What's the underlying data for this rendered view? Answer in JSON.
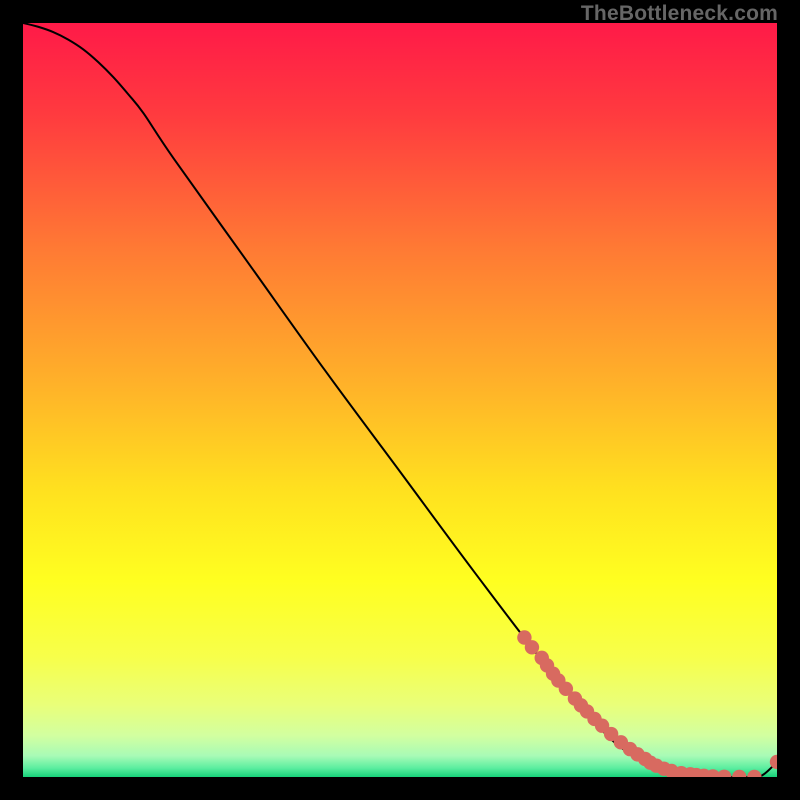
{
  "watermark": "TheBottleneck.com",
  "chart_data": {
    "type": "line",
    "title": "",
    "xlabel": "",
    "ylabel": "",
    "xlim": [
      0,
      100
    ],
    "ylim": [
      0,
      100
    ],
    "background_gradient": {
      "stops": [
        {
          "offset": 0,
          "color": "#ff1a48"
        },
        {
          "offset": 0.12,
          "color": "#ff3a3f"
        },
        {
          "offset": 0.3,
          "color": "#ff7a34"
        },
        {
          "offset": 0.48,
          "color": "#ffb229"
        },
        {
          "offset": 0.62,
          "color": "#ffe11f"
        },
        {
          "offset": 0.74,
          "color": "#ffff20"
        },
        {
          "offset": 0.84,
          "color": "#f7ff4a"
        },
        {
          "offset": 0.905,
          "color": "#e9ff7a"
        },
        {
          "offset": 0.945,
          "color": "#d2ffa0"
        },
        {
          "offset": 0.972,
          "color": "#a8fbb6"
        },
        {
          "offset": 0.988,
          "color": "#5ceea0"
        },
        {
          "offset": 1.0,
          "color": "#17d17a"
        }
      ]
    },
    "series": [
      {
        "name": "curve",
        "type": "line",
        "x": [
          0,
          2,
          4,
          6,
          8,
          10,
          12,
          14,
          16,
          20,
          30,
          40,
          50,
          60,
          70,
          78,
          82,
          85,
          88,
          90,
          92,
          94,
          96,
          98,
          100
        ],
        "y": [
          100,
          99.5,
          98.8,
          97.8,
          96.5,
          94.8,
          92.8,
          90.5,
          88,
          82,
          68,
          54,
          40.5,
          27,
          14,
          5,
          2.5,
          1.2,
          0.5,
          0.2,
          0.05,
          0,
          0,
          0.2,
          2.0
        ]
      },
      {
        "name": "points",
        "type": "scatter",
        "color": "#d86a60",
        "x": [
          66.5,
          67.5,
          68.8,
          69.5,
          70.3,
          71.0,
          72.0,
          73.2,
          74.0,
          74.8,
          75.8,
          76.8,
          78.0,
          79.3,
          80.5,
          81.5,
          82.5,
          83.2,
          84.0,
          85.0,
          86.0,
          87.3,
          88.5,
          89.3,
          90.3,
          91.5,
          93.0,
          95.0,
          97.0,
          100.0
        ],
        "y": [
          18.5,
          17.2,
          15.8,
          14.8,
          13.7,
          12.8,
          11.7,
          10.4,
          9.5,
          8.7,
          7.7,
          6.8,
          5.7,
          4.6,
          3.7,
          3.0,
          2.4,
          1.9,
          1.5,
          1.1,
          0.8,
          0.5,
          0.35,
          0.25,
          0.15,
          0.08,
          0.03,
          0.0,
          0.0,
          2.0
        ]
      }
    ]
  }
}
